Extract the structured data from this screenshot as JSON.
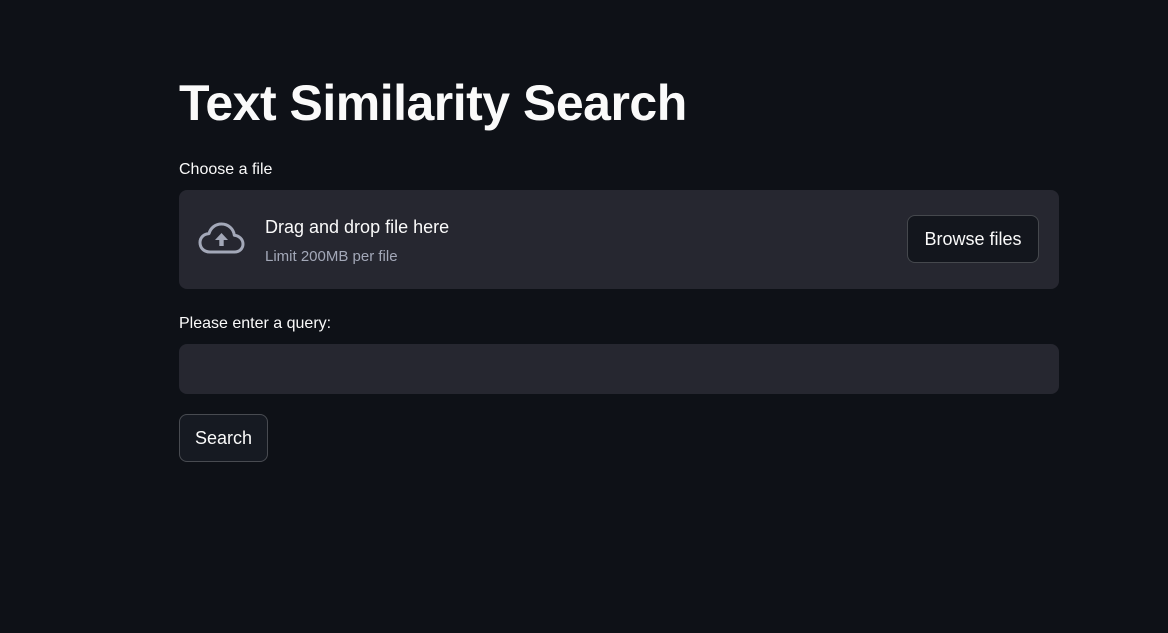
{
  "page": {
    "title": "Text Similarity Search"
  },
  "file_uploader": {
    "label": "Choose a file",
    "dropzone_title": "Drag and drop file here",
    "limit_text": "Limit 200MB per file",
    "browse_label": "Browse files",
    "icon": "cloud-upload-icon"
  },
  "query": {
    "label": "Please enter a query:",
    "value": "",
    "placeholder": ""
  },
  "actions": {
    "search_label": "Search"
  },
  "colors": {
    "background": "#0e1117",
    "surface": "#262730",
    "text": "#fafafa",
    "muted_text": "#a3a8b8"
  }
}
